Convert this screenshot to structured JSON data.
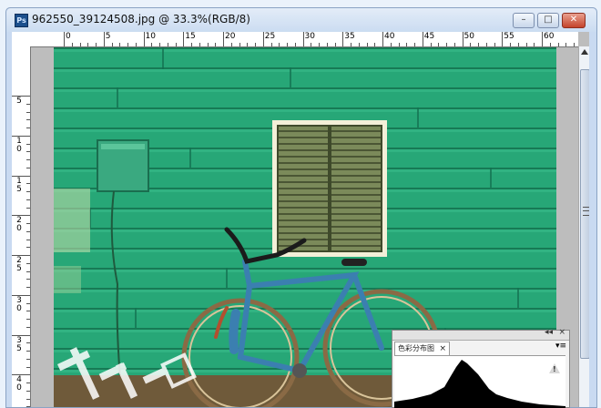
{
  "window": {
    "title": "962550_39124508.jpg @ 33.3%(RGB/8)",
    "app_icon_text": "Ps",
    "minimize_glyph": "–",
    "maximize_glyph": "□",
    "close_glyph": "✕"
  },
  "ruler": {
    "horizontal_labels": [
      "0",
      "5",
      "10",
      "15",
      "20",
      "25",
      "30",
      "35",
      "40",
      "45",
      "50",
      "55",
      "60"
    ],
    "vertical_labels": [
      "5",
      "1\n0",
      "1\n5",
      "2\n0",
      "2\n5",
      "3\n0",
      "3\n5",
      "4\n0"
    ]
  },
  "histogram_panel": {
    "tab_label": "色彩分布图",
    "tab_close_glyph": "×",
    "collapse_glyph": "◂◂",
    "close_glyph": "×",
    "menu_glyph": "▾≡",
    "warning_glyph": "!"
  },
  "colors": {
    "wall_green": "#27a777",
    "shutter_green": "#7c8c5c",
    "bike_blue": "#3b7fb0",
    "window_chrome": "#c9daf1"
  }
}
